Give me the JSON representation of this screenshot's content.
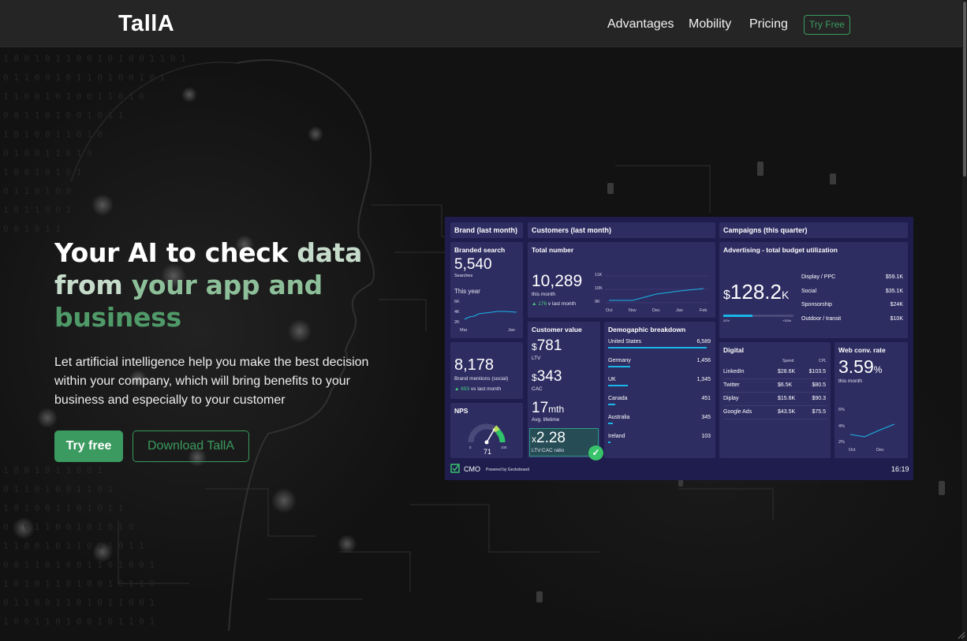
{
  "nav": {
    "brand": "TallA",
    "links": [
      "Advantages",
      "Mobility",
      "Pricing"
    ],
    "cta": "Try Free"
  },
  "hero": {
    "headline_a": "Your AI to check",
    "headline_b": "data",
    "headline_c": "from",
    "headline_d": "your",
    "headline_e": "app and",
    "headline_f": "business",
    "subtext": "Let artificial intelligence help you make the best decision within your company, which will bring benefits to your business and especially to your customer",
    "primary_button": "Try free",
    "secondary_button": "Download TallA"
  },
  "dashboard": {
    "headers": {
      "brand": "Brand (last month)",
      "customers": "Customers (last month)",
      "campaigns": "Campaigns (this quarter)"
    },
    "branded_search": {
      "title": "Branded search",
      "value": "5,540",
      "unit": "Searches",
      "period": "This year",
      "y_ticks": [
        "6K",
        "4K",
        "2K"
      ],
      "x_ticks": [
        "Mar",
        "Jan"
      ]
    },
    "mentions": {
      "value": "8,178",
      "label": "Brand mentions (social)",
      "delta": "693",
      "delta_suffix": "vs last month"
    },
    "nps": {
      "title": "NPS",
      "value": "71",
      "min": "0",
      "max": "100"
    },
    "total_number": {
      "title": "Total number",
      "value": "10,289",
      "period": "this month",
      "delta": "176",
      "delta_suffix": "v last month",
      "y_ticks": [
        "11K",
        "10K",
        "9K"
      ],
      "x_ticks": [
        "Oct",
        "Nov",
        "Dec",
        "Jan",
        "Feb"
      ]
    },
    "customer_value": {
      "title": "Customer value",
      "ltv": "781",
      "ltv_label": "LTV",
      "cac": "343",
      "cac_label": "CAC",
      "lifetime": "17",
      "lifetime_unit": "mth",
      "lifetime_label": "Avg. lifetime",
      "ratio": "2.28",
      "ratio_label": "LTV:CAC ratio",
      "currency": "$",
      "times": "x"
    },
    "demographic": {
      "title": "Demogaphic breakdown",
      "rows": [
        {
          "country": "United States",
          "value": "6,589",
          "share": 1.0
        },
        {
          "country": "Germany",
          "value": "1,456",
          "share": 0.22
        },
        {
          "country": "UK",
          "value": "1,345",
          "share": 0.2
        },
        {
          "country": "Canada",
          "value": "451",
          "share": 0.07
        },
        {
          "country": "Australia",
          "value": "345",
          "share": 0.05
        },
        {
          "country": "Ireland",
          "value": "103",
          "share": 0.02
        }
      ]
    },
    "advertising": {
      "title": "Advertising - total budget utilization",
      "currency": "$",
      "value": "128.2",
      "unit": "K",
      "progress": 0.42,
      "progress_min": "42%",
      "progress_max": "+300k",
      "rows": [
        {
          "label": "Display / PPC",
          "value": "$59.1K"
        },
        {
          "label": "Social",
          "value": "$35.1K"
        },
        {
          "label": "Sponsorship",
          "value": "$24K"
        },
        {
          "label": "Outdoor / transit",
          "value": "$10K"
        }
      ]
    },
    "digital": {
      "title": "Digital",
      "col_spend": "Spend",
      "col_cpl": "CPL",
      "rows": [
        {
          "channel": "LinkedIn",
          "spend": "$28.6K",
          "cpl": "$103.5"
        },
        {
          "channel": "Twitter",
          "spend": "$6.5K",
          "cpl": "$80.5"
        },
        {
          "channel": "Diplay",
          "spend": "$15.6K",
          "cpl": "$90.3"
        },
        {
          "channel": "Google Ads",
          "spend": "$43.5K",
          "cpl": "$75.5"
        }
      ]
    },
    "web_conv": {
      "title": "Web conv. rate",
      "value": "3.59",
      "unit": "%",
      "period": "this month",
      "y_ticks": [
        "6%",
        "4%",
        "2%"
      ],
      "x_ticks": [
        "Oct",
        "Dec"
      ]
    },
    "footer": {
      "name": "CMO",
      "powered": "Powered by Geckoboard",
      "time": "16:19"
    }
  }
}
